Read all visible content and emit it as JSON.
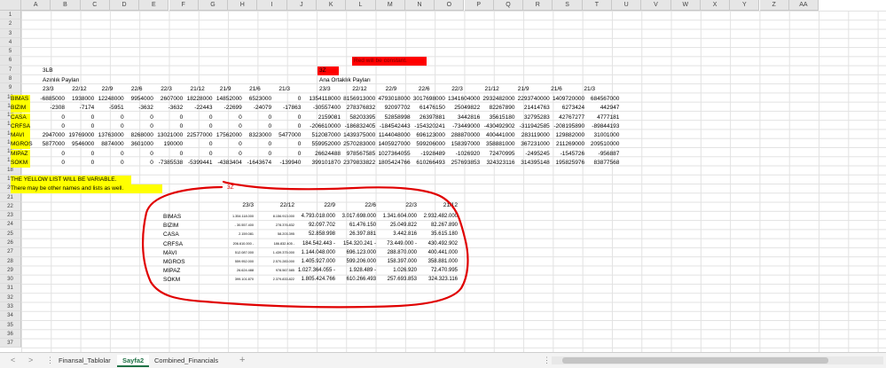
{
  "columns": [
    "A",
    "B",
    "C",
    "D",
    "E",
    "F",
    "G",
    "H",
    "I",
    "J",
    "K",
    "L",
    "M",
    "N",
    "O",
    "P",
    "Q",
    "R",
    "S",
    "T",
    "U",
    "V",
    "W",
    "X",
    "Y",
    "Z",
    "AA"
  ],
  "rows": [
    "1",
    "2",
    "3",
    "4",
    "5",
    "6",
    "7",
    "8",
    "9",
    "10",
    "11",
    "12",
    "13",
    "14",
    "15",
    "16",
    "17",
    "18",
    "19",
    "20",
    "21",
    "22",
    "23",
    "24",
    "25",
    "26",
    "27",
    "28",
    "29",
    "30",
    "31",
    "32",
    "33",
    "34",
    "35",
    "36",
    "37"
  ],
  "labels": {
    "red_note": "Red will be constant.",
    "b6": "3LB",
    "k6": "3Z",
    "b7": "Azınlık Payları",
    "k7": "Ana Ortaklık Payları",
    "note1": "THE YELLOW LIST WILL BE VARIABLE.",
    "note2": "There may be other names and lists as well.",
    "red_3z": "3Z"
  },
  "left_headers": [
    "23/3",
    "22/12",
    "22/9",
    "22/6",
    "22/3",
    "21/12",
    "21/9",
    "21/6",
    "21/3"
  ],
  "right_headers": [
    "23/3",
    "22/12",
    "22/9",
    "22/6",
    "22/3",
    "21/12",
    "21/9",
    "21/6",
    "21/3"
  ],
  "companies": [
    "BIMAS",
    "BIZIM",
    "CASA",
    "CRFSA",
    "MAVI",
    "MGROS",
    "MIPAZ",
    "SOKM"
  ],
  "left_values": [
    [
      "-6885000",
      "1938000",
      "12248000",
      "9954000",
      "2607000",
      "18228000",
      "14852000",
      "6523000",
      "0"
    ],
    [
      "-2308",
      "-7174",
      "-5951",
      "-3632",
      "-3632",
      "-22443",
      "-22699",
      "-24079",
      "-17863"
    ],
    [
      "0",
      "0",
      "0",
      "0",
      "0",
      "0",
      "0",
      "0",
      "0"
    ],
    [
      "0",
      "0",
      "0",
      "0",
      "0",
      "0",
      "0",
      "0",
      "0"
    ],
    [
      "2947000",
      "19769000",
      "13763000",
      "8268000",
      "13021000",
      "22577000",
      "17562000",
      "8323000",
      "5477000"
    ],
    [
      "5877000",
      "9546000",
      "8874000",
      "3601000",
      "190000",
      "0",
      "0",
      "0",
      "0"
    ],
    [
      "0",
      "0",
      "0",
      "0",
      "0",
      "0",
      "0",
      "0",
      "0"
    ],
    [
      "0",
      "0",
      "0",
      "0",
      "-7385538",
      "-5399441",
      "-4383404",
      "-1643674",
      "-139940"
    ]
  ],
  "right_values": [
    [
      "1354118000",
      "8156913000",
      "4793018000",
      "3017698000",
      "1341604000",
      "2932482000",
      "2293740000",
      "1409720000",
      "684567000"
    ],
    [
      "-30557400",
      "278376832",
      "92097702",
      "61476150",
      "25049822",
      "82267890",
      "21414763",
      "6273424",
      "442947"
    ],
    [
      "2159081",
      "58203395",
      "52858998",
      "26397881",
      "3442816",
      "35615180",
      "32795283",
      "42767277",
      "4777181"
    ],
    [
      "-206610000",
      "-186832405",
      "-184542443",
      "-154320241",
      "-73449000",
      "-430492902",
      "-311942585",
      "-208195890",
      "-89844193"
    ],
    [
      "512087000",
      "1439375000",
      "1144048000",
      "696123000",
      "288870000",
      "400441000",
      "283119000",
      "129882000",
      "31001000"
    ],
    [
      "559952000",
      "2570283000",
      "1405927000",
      "599206000",
      "158397000",
      "358881000",
      "367231000",
      "211269000",
      "209510000"
    ],
    [
      "26624488",
      "978567585",
      "1027364055",
      "-1928489",
      "-1026920",
      "72470995",
      "-2495245",
      "-1545726",
      "-956887"
    ],
    [
      "399101870",
      "2379833822",
      "1805424766",
      "610266493",
      "257693853",
      "324323116",
      "314395148",
      "195825976",
      "83877568"
    ]
  ],
  "summary_headers": [
    "23/3",
    "22/12",
    "22/9",
    "22/6",
    "22/3",
    "21/12"
  ],
  "summary_values": [
    [
      "1.354.118.000",
      "8.156.913.000",
      "4.793.018.000",
      "3.017.698.000",
      "1.341.604.000",
      "2.932.482.000"
    ],
    [
      "- 30.557.400",
      "278.376.832",
      "92.097.702",
      "61.476.150",
      "25.049.822",
      "82.267.890"
    ],
    [
      "2.159.081",
      "58.203.395",
      "52.858.998",
      "26.397.881",
      "3.442.816",
      "35.615.180"
    ],
    [
      "206.610.000 -",
      "186.832.405 -",
      "184.542.443 -",
      "154.320.241 -",
      "73.449.000 -",
      "430.492.902"
    ],
    [
      "512.087.000",
      "1.439.375.000",
      "1.144.048.000",
      "696.123.000",
      "288.870.000",
      "400.441.000"
    ],
    [
      "559.952.000",
      "2.570.283.000",
      "1.405.927.000",
      "599.206.000",
      "158.397.000",
      "358.881.000"
    ],
    [
      "26.624.488",
      "978.567.585",
      "1.027.364.055 -",
      "1.928.489 -",
      "1.026.920",
      "72.470.995"
    ],
    [
      "399.101.870",
      "2.379.833.822",
      "1.805.424.766",
      "610.266.493",
      "257.693.853",
      "324.323.116"
    ]
  ],
  "tabs": [
    "Finansal_Tablolar",
    "Sayfa2",
    "Combined_Financials"
  ],
  "active_tab": "Sayfa2",
  "nav_prev": "<",
  "nav_next": ">",
  "add_sheet": "+",
  "more": "⋮",
  "colors": {
    "yellow": "#ffff00",
    "red": "#ff0000",
    "outline": "#e00000",
    "accent": "#1e7145"
  }
}
